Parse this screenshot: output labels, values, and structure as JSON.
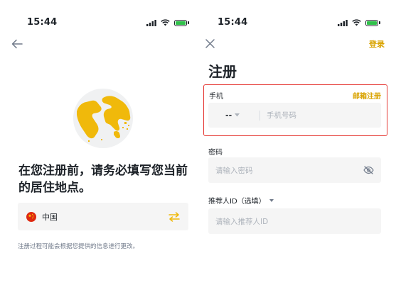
{
  "left_screen": {
    "status": {
      "time": "15:44"
    },
    "heading_line1": "在您注册前，请务必填写您当前",
    "heading_line2": "的居住地点。",
    "country": {
      "name": "中国"
    },
    "hint": "注册过程可能会根据您提供的信息进行更改。"
  },
  "right_screen": {
    "status": {
      "time": "15:44"
    },
    "login_link": "登录",
    "title": "注册",
    "phone": {
      "label": "手机",
      "switch_link": "邮箱注册",
      "country_code": "--",
      "placeholder": "手机号码"
    },
    "password": {
      "label": "密码",
      "placeholder": "请输入密码"
    },
    "referral": {
      "label": "推荐人ID（选填）",
      "placeholder": "请输入推荐人ID"
    }
  },
  "colors": {
    "accent_yellow": "#f0b90b",
    "highlight_red": "#e53935",
    "input_bg": "#f5f5f5"
  }
}
